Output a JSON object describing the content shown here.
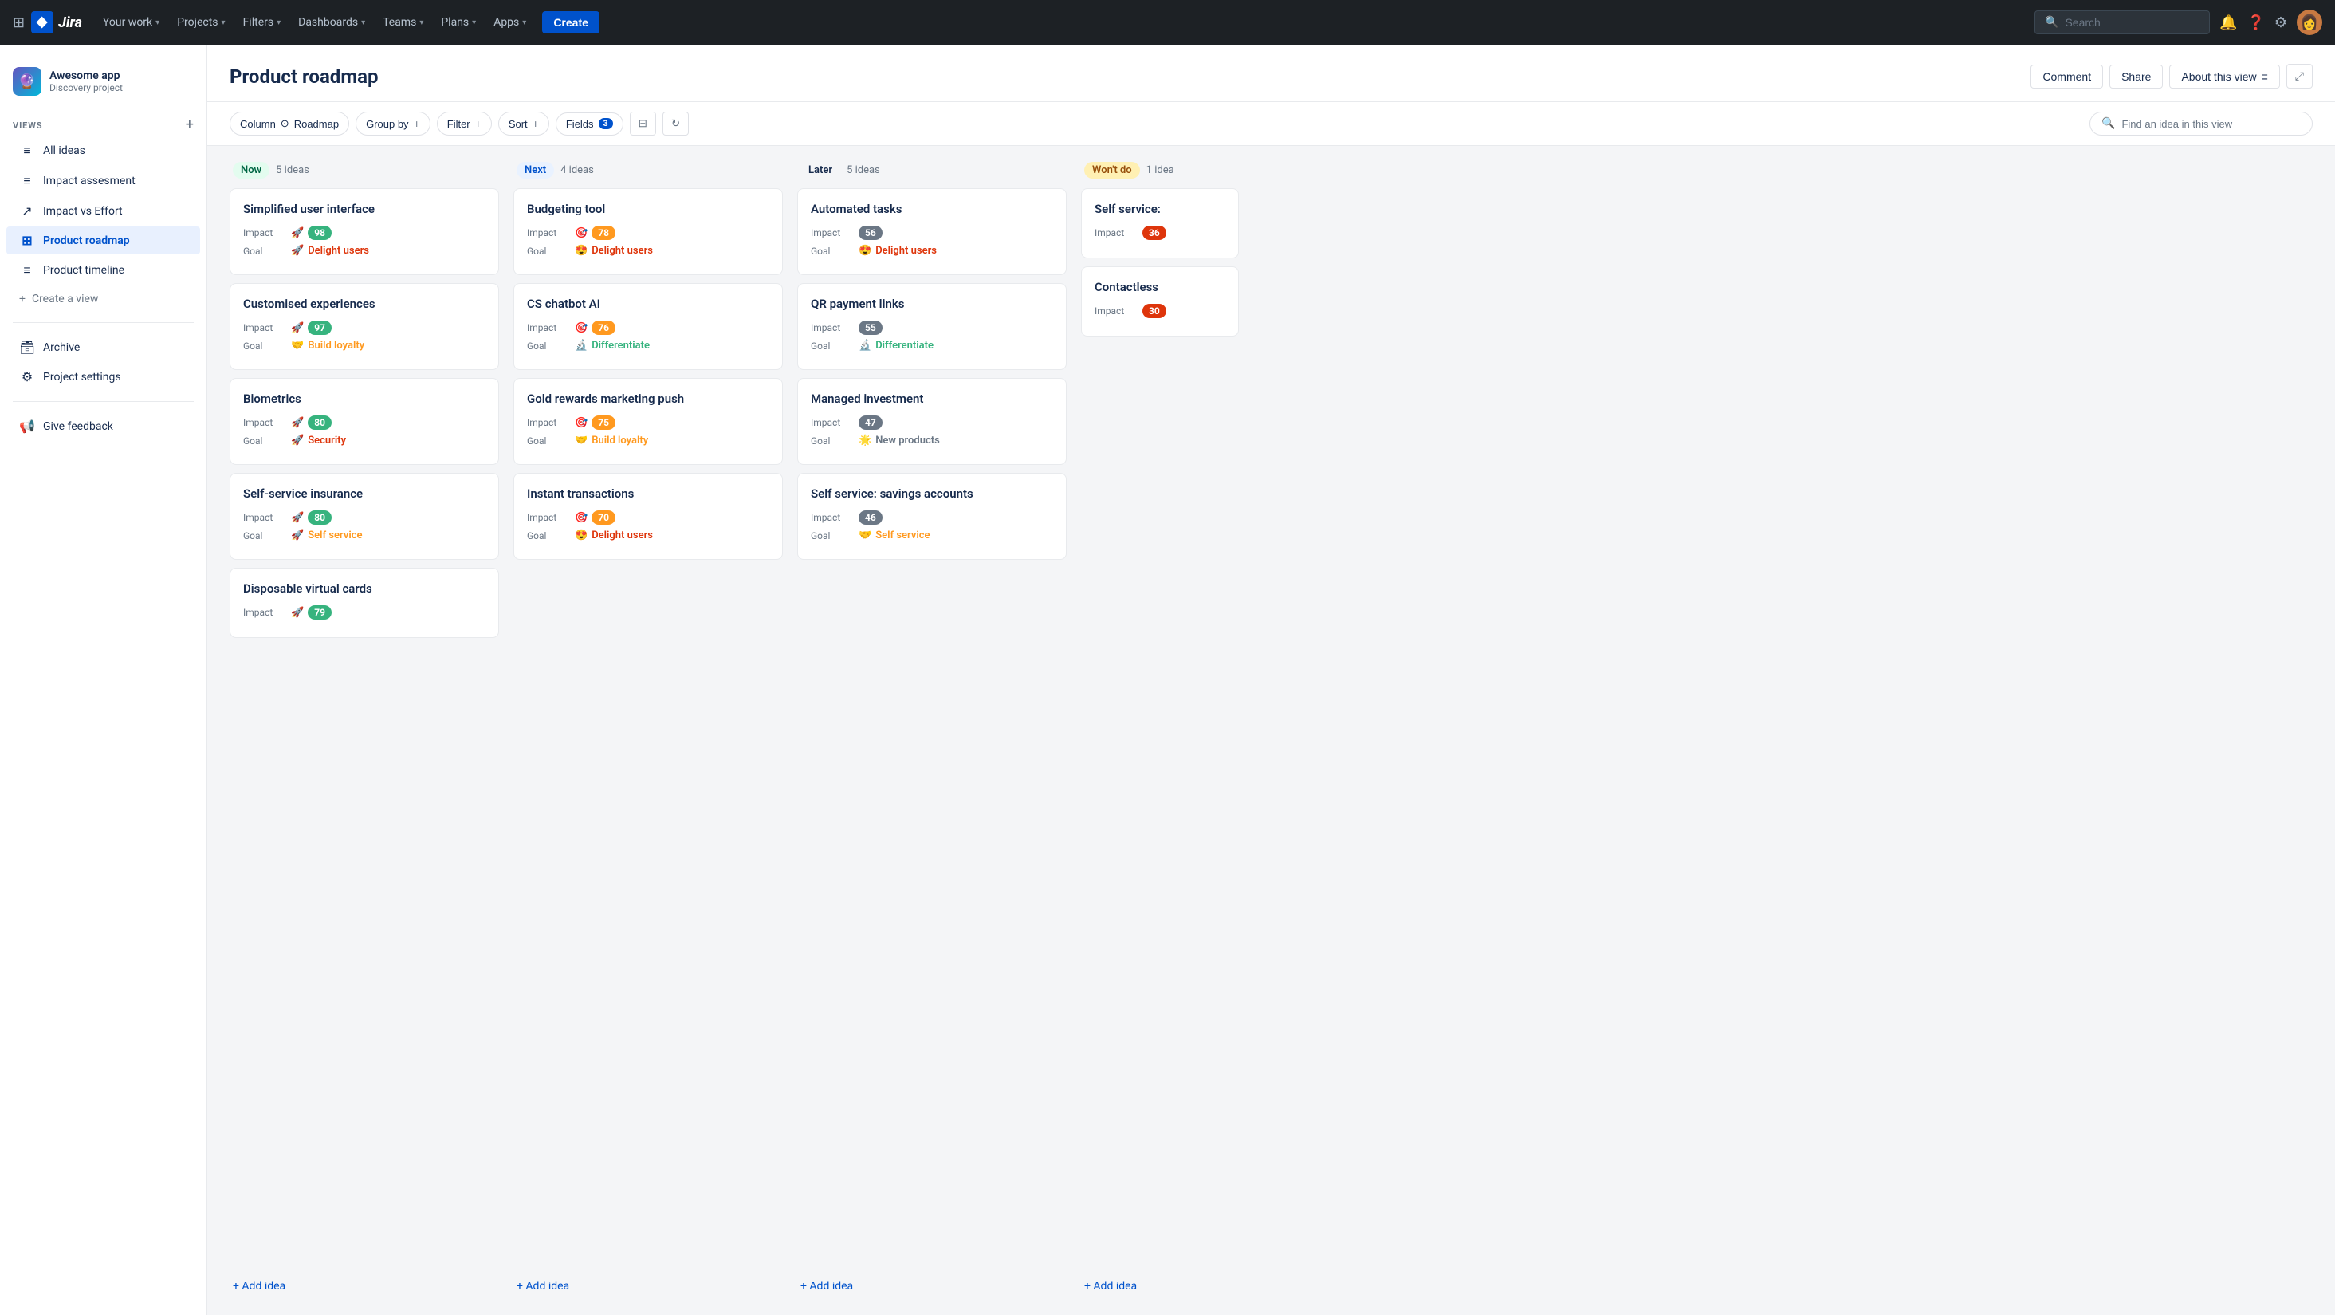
{
  "topnav": {
    "logo_text": "Jira",
    "items": [
      {
        "label": "Your work",
        "has_chevron": true
      },
      {
        "label": "Projects",
        "has_chevron": true
      },
      {
        "label": "Filters",
        "has_chevron": true
      },
      {
        "label": "Dashboards",
        "has_chevron": true
      },
      {
        "label": "Teams",
        "has_chevron": true
      },
      {
        "label": "Plans",
        "has_chevron": true
      },
      {
        "label": "Apps",
        "has_chevron": true
      }
    ],
    "create_label": "Create",
    "search_placeholder": "Search"
  },
  "sidebar": {
    "project_name": "Awesome app",
    "project_sub": "Discovery project",
    "views_label": "VIEWS",
    "items": [
      {
        "label": "All ideas",
        "icon": "≡",
        "active": false
      },
      {
        "label": "Impact assesment",
        "icon": "≡",
        "active": false
      },
      {
        "label": "Impact vs Effort",
        "icon": "↗",
        "active": false
      },
      {
        "label": "Product roadmap",
        "icon": "⊞",
        "active": true
      },
      {
        "label": "Product timeline",
        "icon": "≡",
        "active": false
      }
    ],
    "create_view_label": "Create a view",
    "archive_label": "Archive",
    "project_settings_label": "Project settings",
    "give_feedback_label": "Give feedback"
  },
  "page": {
    "title": "Product roadmap",
    "comment_label": "Comment",
    "share_label": "Share",
    "about_label": "About this view"
  },
  "toolbar": {
    "column_label": "Column",
    "column_icon": "⊙",
    "roadmap_label": "Roadmap",
    "groupby_label": "Group by",
    "filter_label": "Filter",
    "sort_label": "Sort",
    "fields_label": "Fields",
    "fields_count": "3",
    "search_placeholder": "Find an idea in this view"
  },
  "columns": [
    {
      "id": "now",
      "tag": "Now",
      "tag_class": "tag-now",
      "count": "5 ideas",
      "cards": [
        {
          "title": "Simplified user interface",
          "impact": 98,
          "impact_color": "#36b37e",
          "goal_emoji": "🚀",
          "goal": "Delight users",
          "goal_color": "#de350b"
        },
        {
          "title": "Customised experiences",
          "impact": 97,
          "impact_color": "#36b37e",
          "goal_emoji": "🤝",
          "goal": "Build loyalty",
          "goal_color": "#ff991f"
        },
        {
          "title": "Biometrics",
          "impact": 80,
          "impact_color": "#36b37e",
          "goal_emoji": "🚀",
          "goal": "Security",
          "goal_color": "#de350b"
        },
        {
          "title": "Self-service insurance",
          "impact": 80,
          "impact_color": "#36b37e",
          "goal_emoji": "🚀",
          "goal": "Self service",
          "goal_color": "#ff991f"
        },
        {
          "title": "Disposable virtual cards",
          "impact": 79,
          "impact_color": "#36b37e",
          "goal_emoji": null,
          "goal": null
        }
      ]
    },
    {
      "id": "next",
      "tag": "Next",
      "tag_class": "tag-next",
      "count": "4 ideas",
      "cards": [
        {
          "title": "Budgeting tool",
          "impact": 78,
          "impact_color": "#ff991f",
          "goal_emoji": "😍",
          "goal": "Delight users",
          "goal_color": "#de350b"
        },
        {
          "title": "CS chatbot AI",
          "impact": 76,
          "impact_color": "#ff991f",
          "goal_emoji": "🔬",
          "goal": "Differentiate",
          "goal_color": "#36b37e"
        },
        {
          "title": "Gold rewards marketing push",
          "impact": 75,
          "impact_color": "#ff991f",
          "goal_emoji": "🤝",
          "goal": "Build loyalty",
          "goal_color": "#ff991f"
        },
        {
          "title": "Instant transactions",
          "impact": 70,
          "impact_color": "#ff991f",
          "goal_emoji": "😍",
          "goal": "Delight users",
          "goal_color": "#de350b"
        }
      ]
    },
    {
      "id": "later",
      "tag": "Later",
      "tag_class": "tag-later",
      "count": "5 ideas",
      "cards": [
        {
          "title": "Automated tasks",
          "impact": 56,
          "impact_color": "#6b7785",
          "goal_emoji": "😍",
          "goal": "Delight users",
          "goal_color": "#de350b"
        },
        {
          "title": "QR payment links",
          "impact": 55,
          "impact_color": "#6b7785",
          "goal_emoji": "🔬",
          "goal": "Differentiate",
          "goal_color": "#36b37e"
        },
        {
          "title": "Managed investment",
          "impact": 47,
          "impact_color": "#6b7785",
          "goal_emoji": "🌟",
          "goal": "New products",
          "goal_color": "#6b7785"
        },
        {
          "title": "Self service: savings accounts",
          "impact": 46,
          "impact_color": "#6b7785",
          "goal_emoji": "🤝",
          "goal": "Self service",
          "goal_color": "#ff991f"
        }
      ]
    },
    {
      "id": "wontdo",
      "tag": "Won't do",
      "tag_class": "tag-wontdo",
      "count": "1 idea",
      "cards": [
        {
          "title": "Self service:",
          "impact": 36,
          "impact_color": "#de350b",
          "goal_emoji": null,
          "goal": null
        },
        {
          "title": "Contactless",
          "impact": 30,
          "impact_color": "#de350b",
          "goal_emoji": null,
          "goal": null
        }
      ]
    }
  ],
  "add_idea_label": "+ Add idea"
}
